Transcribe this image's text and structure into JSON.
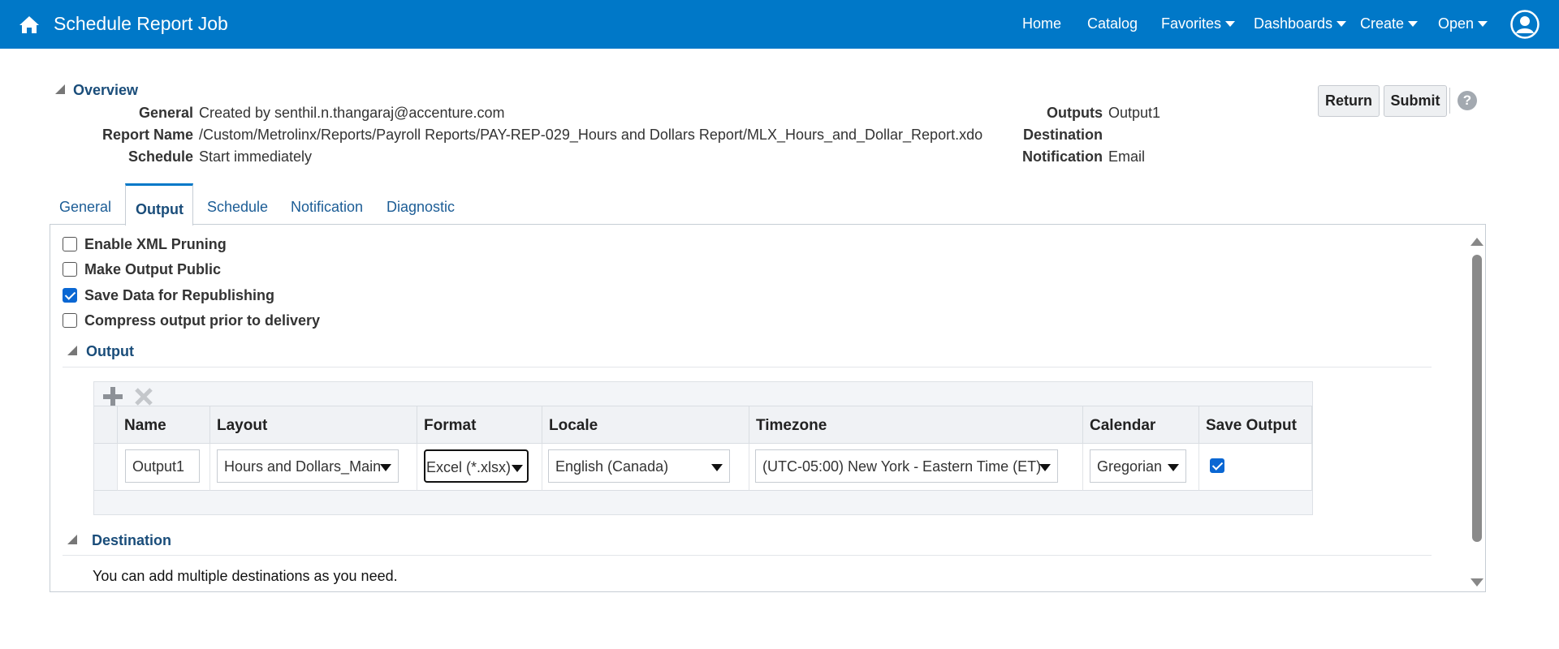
{
  "header": {
    "title": "Schedule Report Job",
    "nav": [
      {
        "label": "Home",
        "dropdown": false
      },
      {
        "label": "Catalog",
        "dropdown": false
      },
      {
        "label": "Favorites",
        "dropdown": true
      },
      {
        "label": "Dashboards",
        "dropdown": true
      },
      {
        "label": "Create",
        "dropdown": true
      },
      {
        "label": "Open",
        "dropdown": true
      }
    ],
    "icons": {
      "home": "home-icon",
      "user": "user-avatar-icon"
    },
    "color": "#0078c8"
  },
  "overview": {
    "title": "Overview",
    "general_label": "General",
    "general_value": "Created by senthil.n.thangaraj@accenture.com",
    "report_name_label": "Report Name",
    "report_name_value": "/Custom/Metrolinx/Reports/Payroll Reports/PAY-REP-029_Hours and Dollars Report/MLX_Hours_and_Dollar_Report.xdo",
    "schedule_label": "Schedule",
    "schedule_value": "Start immediately",
    "outputs_label": "Outputs",
    "outputs_value": "Output1",
    "destination_label": "Destination",
    "destination_value": "",
    "notification_label": "Notification",
    "notification_value": "Email"
  },
  "actions": {
    "return_label": "Return",
    "submit_label": "Submit",
    "help_glyph": "?"
  },
  "tabs": [
    {
      "label": "General",
      "active": false
    },
    {
      "label": "Output",
      "active": true
    },
    {
      "label": "Schedule",
      "active": false
    },
    {
      "label": "Notification",
      "active": false
    },
    {
      "label": "Diagnostic",
      "active": false
    }
  ],
  "options": [
    {
      "label": "Enable XML Pruning",
      "checked": false
    },
    {
      "label": "Make Output Public",
      "checked": false
    },
    {
      "label": "Save Data for Republishing",
      "checked": true
    },
    {
      "label": "Compress output prior to delivery",
      "checked": false
    }
  ],
  "output_section": {
    "title": "Output",
    "columns": [
      "Name",
      "Layout",
      "Format",
      "Locale",
      "Timezone",
      "Calendar",
      "Save Output"
    ],
    "row": {
      "name": "Output1",
      "layout": "Hours and Dollars_Main",
      "format": "Excel (*.xlsx)",
      "locale": "English (Canada)",
      "timezone": "(UTC-05:00) New York - Eastern Time (ET)",
      "calendar": "Gregorian",
      "save_output": true
    },
    "toolbar_icons": [
      "add-icon",
      "delete-icon"
    ]
  },
  "destination_section": {
    "title": "Destination",
    "text": "You can add multiple destinations as you need."
  }
}
